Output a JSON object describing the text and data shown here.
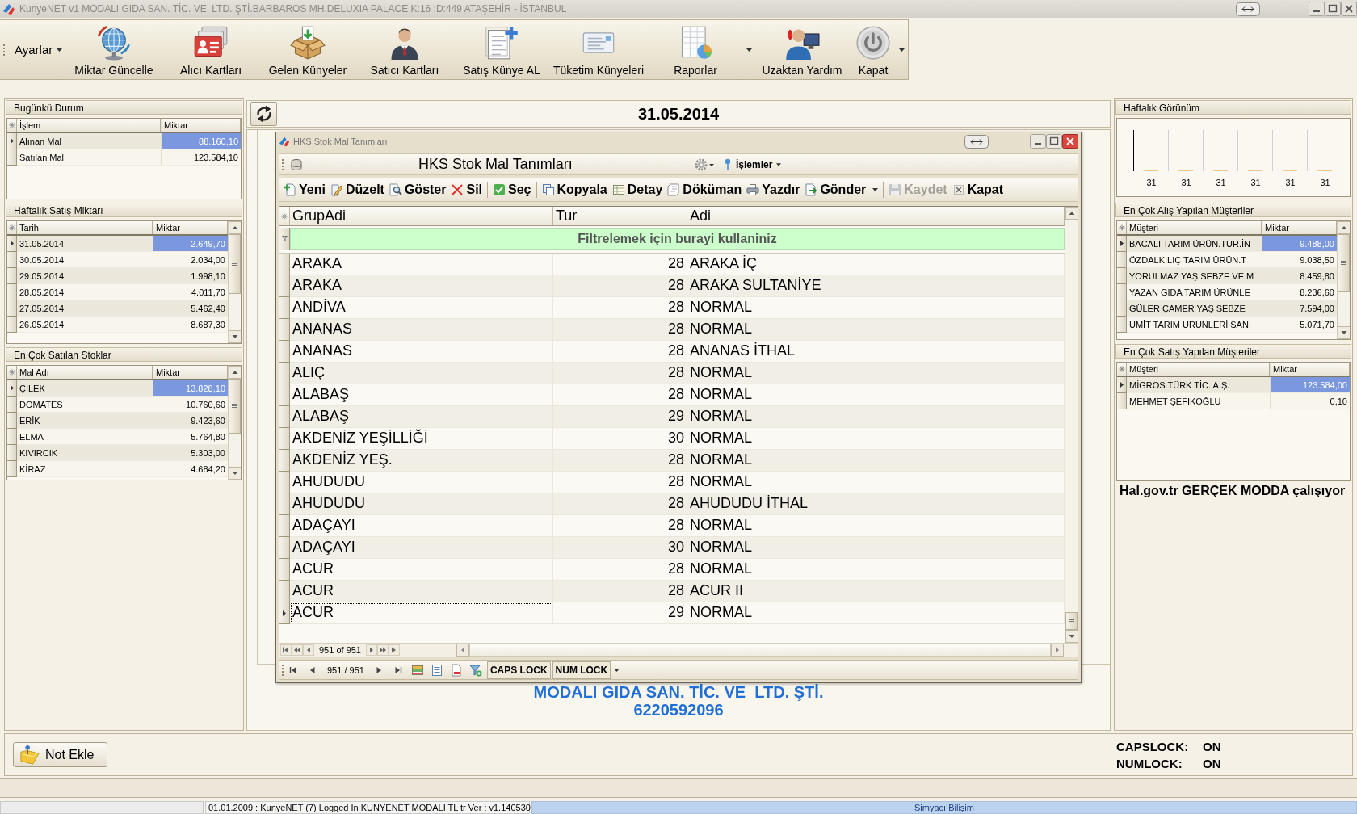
{
  "window": {
    "title": "KunyeNET v1 MODALI GIDA SAN. TİC. VE  LTD. ŞTİ.BARBAROS MH.DELUXIA PALACE K:16 :D:449 ATAŞEHİR - İSTANBUL"
  },
  "toolbar": {
    "settings_menu": "Ayarlar",
    "buttons": [
      {
        "label": "Miktar Güncelle",
        "dropdown": false
      },
      {
        "label": "Alıcı Kartları",
        "dropdown": false
      },
      {
        "label": "Gelen Künyeler",
        "dropdown": false
      },
      {
        "label": "Satıcı Kartları",
        "dropdown": false
      },
      {
        "label": "Satış Künye AL",
        "dropdown": false
      },
      {
        "label": "Tüketim Künyeleri",
        "dropdown": false
      },
      {
        "label": "Raporlar",
        "dropdown": true
      },
      {
        "label": "Uzaktan Yardım",
        "dropdown": false
      },
      {
        "label": "Kapat",
        "dropdown": false
      }
    ]
  },
  "left_panels": [
    {
      "title": "Bugünkü Durum",
      "columns": [
        "İşlem",
        "Miktar"
      ],
      "scrollbar": false,
      "rows": [
        {
          "cells": [
            "Alınan Mal",
            "88.160,10"
          ],
          "selected": true
        },
        {
          "cells": [
            "Satılan Mal",
            "123.584,10"
          ],
          "selected": false
        }
      ]
    },
    {
      "title": "Haftalık Satış Miktarı",
      "columns": [
        "Tarih",
        "Miktar"
      ],
      "scrollbar": true,
      "rows": [
        {
          "cells": [
            "31.05.2014",
            "2.649,70"
          ],
          "selected": true
        },
        {
          "cells": [
            "30.05.2014",
            "2.034,00"
          ],
          "selected": false
        },
        {
          "cells": [
            "29.05.2014",
            "1.998,10"
          ],
          "selected": false
        },
        {
          "cells": [
            "28.05.2014",
            "4.011,70"
          ],
          "selected": false
        },
        {
          "cells": [
            "27.05.2014",
            "5.462,40"
          ],
          "selected": false
        },
        {
          "cells": [
            "26.05.2014",
            "8.687,30"
          ],
          "selected": false
        }
      ]
    },
    {
      "title": "En Çok Satılan Stoklar",
      "columns": [
        "Mal Adı",
        "Miktar"
      ],
      "scrollbar": true,
      "rows": [
        {
          "cells": [
            "ÇİLEK",
            "13.828,10"
          ],
          "selected": true
        },
        {
          "cells": [
            "DOMATES",
            "10.760,60"
          ],
          "selected": false
        },
        {
          "cells": [
            "ERİK",
            "9.423,60"
          ],
          "selected": false
        },
        {
          "cells": [
            "ELMA",
            "5.764,80"
          ],
          "selected": false
        },
        {
          "cells": [
            "KIVIRCIK",
            "5.303,00"
          ],
          "selected": false
        },
        {
          "cells": [
            "KİRAZ",
            "4.684,20"
          ],
          "selected": false
        }
      ]
    }
  ],
  "center": {
    "date": "31.05.2014",
    "company": "MODALI GIDA SAN. TİC. VE  LTD. ŞTİ.",
    "phone": "6220592096"
  },
  "dialog": {
    "title": "HKS Stok Mal Tanımları",
    "heading": "HKS Stok Mal Tanımları",
    "menu": "İşlemler",
    "action_groups": [
      [
        {
          "label": "Yeni",
          "disabled": false,
          "dropdown": false
        },
        {
          "label": "Düzelt",
          "disabled": false,
          "dropdown": false
        },
        {
          "label": "Göster",
          "disabled": false,
          "dropdown": false
        },
        {
          "label": "Sil",
          "disabled": false,
          "dropdown": false
        }
      ],
      [
        {
          "label": "Seç",
          "disabled": false,
          "dropdown": false
        }
      ],
      [
        {
          "label": "Kopyala",
          "disabled": false,
          "dropdown": false
        },
        {
          "label": "Detay",
          "disabled": false,
          "dropdown": false
        },
        {
          "label": "Döküman",
          "disabled": false,
          "dropdown": false
        },
        {
          "label": "Yazdır",
          "disabled": false,
          "dropdown": false
        },
        {
          "label": "Gönder",
          "disabled": false,
          "dropdown": true
        }
      ],
      [
        {
          "label": "Kaydet",
          "disabled": true,
          "dropdown": false
        },
        {
          "label": "Kapat",
          "disabled": false,
          "dropdown": false
        }
      ]
    ],
    "grid": {
      "columns": [
        "GrupAdi",
        "Tur",
        "Adi"
      ],
      "filter_prompt": "Filtrelemek için burayi kullaniniz",
      "rows": [
        {
          "cells": [
            "ARAKA",
            "28",
            "ARAKA İÇ"
          ],
          "selected": false
        },
        {
          "cells": [
            "ARAKA",
            "28",
            "ARAKA SULTANİYE"
          ],
          "selected": false
        },
        {
          "cells": [
            "ANDİVA",
            "28",
            "NORMAL"
          ],
          "selected": false
        },
        {
          "cells": [
            "ANANAS",
            "28",
            "NORMAL"
          ],
          "selected": false
        },
        {
          "cells": [
            "ANANAS",
            "28",
            "ANANAS İTHAL"
          ],
          "selected": false
        },
        {
          "cells": [
            "ALIÇ",
            "28",
            "NORMAL"
          ],
          "selected": false
        },
        {
          "cells": [
            "ALABAŞ",
            "28",
            "NORMAL"
          ],
          "selected": false
        },
        {
          "cells": [
            "ALABAŞ",
            "29",
            "NORMAL"
          ],
          "selected": false
        },
        {
          "cells": [
            "AKDENİZ YEŞİLLİĞİ",
            "30",
            "NORMAL"
          ],
          "selected": false
        },
        {
          "cells": [
            "AKDENİZ YEŞ.",
            "28",
            "NORMAL"
          ],
          "selected": false
        },
        {
          "cells": [
            "AHUDUDU",
            "28",
            "NORMAL"
          ],
          "selected": false
        },
        {
          "cells": [
            "AHUDUDU",
            "28",
            "AHUDUDU İTHAL"
          ],
          "selected": false
        },
        {
          "cells": [
            "ADAÇAYI",
            "28",
            "NORMAL"
          ],
          "selected": false
        },
        {
          "cells": [
            "ADAÇAYI",
            "30",
            "NORMAL"
          ],
          "selected": false
        },
        {
          "cells": [
            "ACUR",
            "28",
            "NORMAL"
          ],
          "selected": false
        },
        {
          "cells": [
            "ACUR",
            "28",
            "ACUR II"
          ],
          "selected": false
        },
        {
          "cells": [
            "ACUR",
            "29",
            "NORMAL"
          ],
          "selected": true
        }
      ]
    },
    "navigator": {
      "position": "951 of 951"
    },
    "status_bar": {
      "position": "951 / 951",
      "indicators": [
        "CAPS LOCK",
        "NUM LOCK"
      ]
    }
  },
  "right_panels": {
    "weekly_view": {
      "title": "Haftalık Görünüm",
      "labels": [
        "31",
        "31",
        "31",
        "31",
        "31",
        "31"
      ]
    },
    "grids": [
      {
        "title": "En Çok Alış Yapılan Müşteriler",
        "columns": [
          "Müşteri",
          "Miktar"
        ],
        "scrollbar": true,
        "rows": [
          {
            "cells": [
              "BACALI TARIM ÜRÜN.TUR.İN",
              "9.488,00"
            ],
            "selected": true
          },
          {
            "cells": [
              "ÖZDALKILIÇ TARIM ÜRÜN.T",
              "9.038,50"
            ],
            "selected": false
          },
          {
            "cells": [
              "YORULMAZ YAŞ SEBZE VE M",
              "8.459,80"
            ],
            "selected": false
          },
          {
            "cells": [
              "YAZAN GIDA TARIM ÜRÜNLE",
              "8.236,60"
            ],
            "selected": false
          },
          {
            "cells": [
              "GÜLER ÇAMER YAŞ SEBZE",
              "7.594,00"
            ],
            "selected": false
          },
          {
            "cells": [
              "ÜMİT TARIM ÜRÜNLERİ SAN.",
              "5.071,70"
            ],
            "selected": false
          }
        ]
      },
      {
        "title": "En Çok Satış Yapılan Müşteriler",
        "columns": [
          "Müşteri",
          "Miktar"
        ],
        "scrollbar": false,
        "rows": [
          {
            "cells": [
              "MİGROS TÜRK TİC. A.Ş.",
              "123.584,00"
            ],
            "selected": true
          },
          {
            "cells": [
              "MEHMET ŞEFİKOĞLU",
              "0,10"
            ],
            "selected": false
          }
        ]
      }
    ],
    "mode_notice": "Hal.gov.tr GERÇEK MODDA çalışıyor"
  },
  "note_button": "Not Ekle",
  "lock_status": [
    {
      "label": "CAPSLOCK:",
      "value": "ON"
    },
    {
      "label": "NUMLOCK:",
      "value": "ON"
    }
  ],
  "status_bar": {
    "panels": [
      "01.01.2009 : KunyeNET (7) Logged In KUNYENET MODALI TL tr Ver : v1.140530",
      "Simyacı Bilişim"
    ]
  }
}
